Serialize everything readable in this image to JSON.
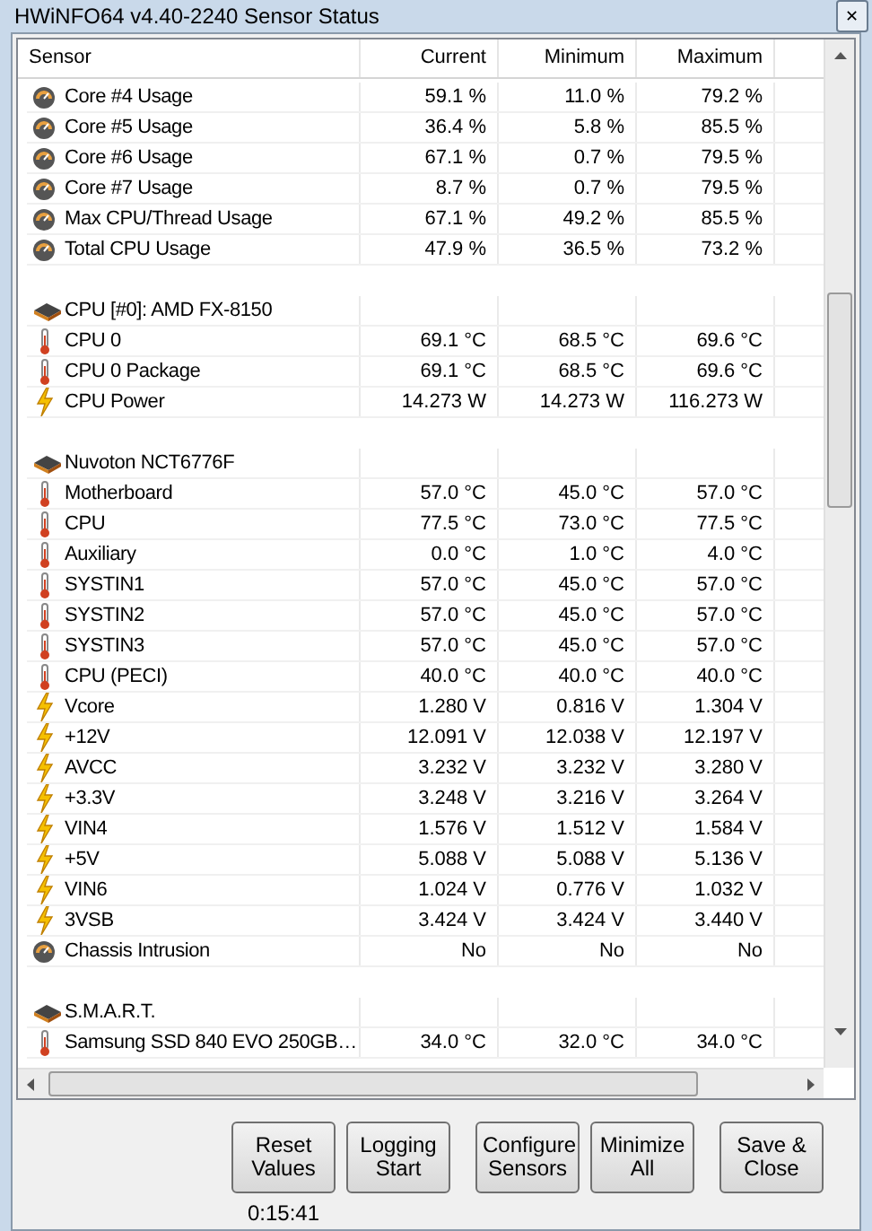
{
  "window": {
    "title": "HWiNFO64 v4.40-2240 Sensor Status",
    "close": "✕"
  },
  "table": {
    "columns": [
      "Sensor",
      "Current",
      "Minimum",
      "Maximum"
    ],
    "rows": [
      {
        "kind": "usage",
        "name": "Core #4 Usage",
        "current": "59.1 %",
        "minimum": "11.0 %",
        "maximum": "79.2 %"
      },
      {
        "kind": "usage",
        "name": "Core #5 Usage",
        "current": "36.4 %",
        "minimum": "5.8 %",
        "maximum": "85.5 %"
      },
      {
        "kind": "usage",
        "name": "Core #6 Usage",
        "current": "67.1 %",
        "minimum": "0.7 %",
        "maximum": "79.5 %"
      },
      {
        "kind": "usage",
        "name": "Core #7 Usage",
        "current": "8.7 %",
        "minimum": "0.7 %",
        "maximum": "79.5 %"
      },
      {
        "kind": "usage",
        "name": "Max CPU/Thread Usage",
        "current": "67.1 %",
        "minimum": "49.2 %",
        "maximum": "85.5 %"
      },
      {
        "kind": "usage",
        "name": "Total CPU Usage",
        "current": "47.9 %",
        "minimum": "36.5 %",
        "maximum": "73.2 %"
      },
      {
        "kind": "spacer"
      },
      {
        "kind": "group",
        "name": "CPU [#0]: AMD FX-8150"
      },
      {
        "kind": "temperature",
        "name": "CPU 0",
        "current": "69.1 °C",
        "minimum": "68.5 °C",
        "maximum": "69.6 °C"
      },
      {
        "kind": "temperature",
        "name": "CPU 0 Package",
        "current": "69.1 °C",
        "minimum": "68.5 °C",
        "maximum": "69.6 °C"
      },
      {
        "kind": "power",
        "name": "CPU Power",
        "current": "14.273 W",
        "minimum": "14.273 W",
        "maximum": "116.273 W"
      },
      {
        "kind": "spacer"
      },
      {
        "kind": "group",
        "name": "Nuvoton NCT6776F"
      },
      {
        "kind": "temperature",
        "name": "Motherboard",
        "current": "57.0 °C",
        "minimum": "45.0 °C",
        "maximum": "57.0 °C"
      },
      {
        "kind": "temperature",
        "name": "CPU",
        "current": "77.5 °C",
        "minimum": "73.0 °C",
        "maximum": "77.5 °C"
      },
      {
        "kind": "temperature",
        "name": "Auxiliary",
        "current": "0.0 °C",
        "minimum": "1.0 °C",
        "maximum": "4.0 °C"
      },
      {
        "kind": "temperature",
        "name": "SYSTIN1",
        "current": "57.0 °C",
        "minimum": "45.0 °C",
        "maximum": "57.0 °C"
      },
      {
        "kind": "temperature",
        "name": "SYSTIN2",
        "current": "57.0 °C",
        "minimum": "45.0 °C",
        "maximum": "57.0 °C"
      },
      {
        "kind": "temperature",
        "name": "SYSTIN3",
        "current": "57.0 °C",
        "minimum": "45.0 °C",
        "maximum": "57.0 °C"
      },
      {
        "kind": "temperature",
        "name": "CPU (PECI)",
        "current": "40.0 °C",
        "minimum": "40.0 °C",
        "maximum": "40.0 °C"
      },
      {
        "kind": "power",
        "name": "Vcore",
        "current": "1.280 V",
        "minimum": "0.816 V",
        "maximum": "1.304 V"
      },
      {
        "kind": "power",
        "name": "+12V",
        "current": "12.091 V",
        "minimum": "12.038 V",
        "maximum": "12.197 V"
      },
      {
        "kind": "power",
        "name": "AVCC",
        "current": "3.232 V",
        "minimum": "3.232 V",
        "maximum": "3.280 V"
      },
      {
        "kind": "power",
        "name": "+3.3V",
        "current": "3.248 V",
        "minimum": "3.216 V",
        "maximum": "3.264 V"
      },
      {
        "kind": "power",
        "name": "VIN4",
        "current": "1.576 V",
        "minimum": "1.512 V",
        "maximum": "1.584 V"
      },
      {
        "kind": "power",
        "name": "+5V",
        "current": "5.088 V",
        "minimum": "5.088 V",
        "maximum": "5.136 V"
      },
      {
        "kind": "power",
        "name": "VIN6",
        "current": "1.024 V",
        "minimum": "0.776 V",
        "maximum": "1.032 V"
      },
      {
        "kind": "power",
        "name": "3VSB",
        "current": "3.424 V",
        "minimum": "3.424 V",
        "maximum": "3.440 V"
      },
      {
        "kind": "usage",
        "name": "Chassis Intrusion",
        "current": "No",
        "minimum": "No",
        "maximum": "No"
      },
      {
        "kind": "spacer"
      },
      {
        "kind": "group",
        "name": "S.M.A.R.T."
      },
      {
        "kind": "temperature",
        "name": "Samsung SSD 840 EVO 250GB…",
        "current": "34.0 °C",
        "minimum": "32.0 °C",
        "maximum": "34.0 °C"
      }
    ]
  },
  "buttons": [
    {
      "label": "Reset Values"
    },
    {
      "label": "Logging Start"
    },
    {
      "label": "Configure Sensors"
    },
    {
      "label": "Minimize All"
    },
    {
      "label": "Save & Close"
    }
  ],
  "timer": "0:15:41"
}
